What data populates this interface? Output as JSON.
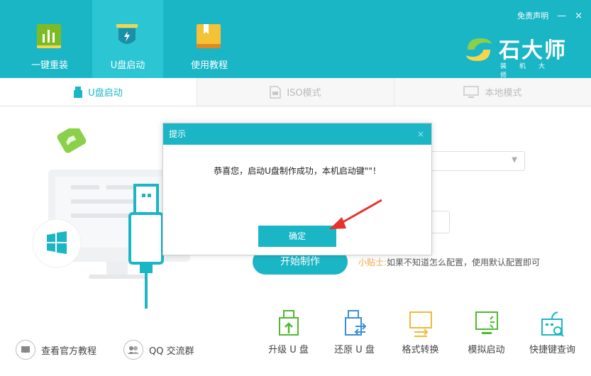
{
  "header": {
    "nav": [
      {
        "label": "一键重装",
        "icon": "bar-chart-icon"
      },
      {
        "label": "U盘启动",
        "icon": "usb-flash-icon"
      },
      {
        "label": "使用教程",
        "icon": "bookmark-icon"
      }
    ],
    "disclaimer": "免责声明",
    "minimize": "—",
    "close": "×",
    "brand_name": "石大师",
    "brand_sub": "装机大师"
  },
  "tabs": [
    {
      "label": "U盘启动",
      "icon": "usb-icon"
    },
    {
      "label": "ISO模式",
      "icon": "file-icon"
    },
    {
      "label": "本地模式",
      "icon": "monitor-icon"
    }
  ],
  "main": {
    "start_button": "开始制作",
    "tip_label": "小贴士:",
    "tip_text": "如果不知道怎么配置，使用默认配置即可",
    "select_arrow": "▼"
  },
  "bottom_links": [
    {
      "label": "查看官方教程",
      "icon": "book-icon"
    },
    {
      "label": "QQ 交流群",
      "icon": "users-icon"
    }
  ],
  "tools": [
    {
      "label": "升级 U 盘",
      "icon": "usb-upgrade-icon"
    },
    {
      "label": "还原 U 盘",
      "icon": "usb-restore-icon"
    },
    {
      "label": "格式转换",
      "icon": "format-convert-icon"
    },
    {
      "label": "模拟启动",
      "icon": "simulate-boot-icon"
    },
    {
      "label": "快捷键查询",
      "icon": "shortcut-search-icon"
    }
  ],
  "modal": {
    "title": "提示",
    "close": "×",
    "message": "恭喜您，启动U盘制作成功，本机启动键\"\"！",
    "ok_button": "确定"
  },
  "colors": {
    "accent": "#1ab6c6",
    "tip_orange": "#f0a642",
    "arrow_red": "#e8322e"
  }
}
